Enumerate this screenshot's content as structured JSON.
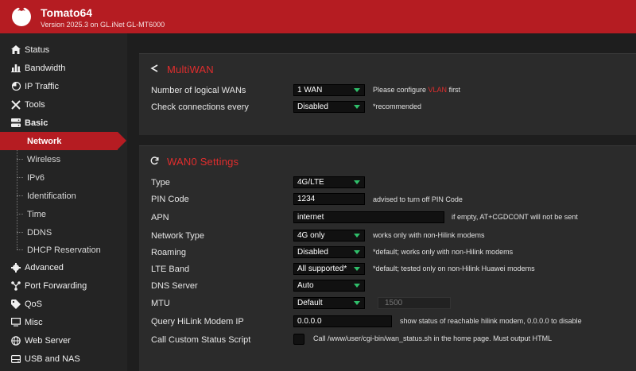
{
  "header": {
    "title": "Tomato64",
    "subtitle": "Version 2025.3 on GL.iNet GL-MT6000",
    "accent": "#b51c22"
  },
  "sidebar": {
    "items": [
      {
        "label": "Status",
        "icon": "home-icon"
      },
      {
        "label": "Bandwidth",
        "icon": "bar-chart-icon"
      },
      {
        "label": "IP Traffic",
        "icon": "pie-icon"
      },
      {
        "label": "Tools",
        "icon": "tools-icon"
      },
      {
        "label": "Basic",
        "icon": "server-icon"
      },
      {
        "label": "Advanced",
        "icon": "gear-icon"
      },
      {
        "label": "Port Forwarding",
        "icon": "network-icon"
      },
      {
        "label": "QoS",
        "icon": "tag-icon"
      },
      {
        "label": "Misc",
        "icon": "monitor-icon"
      },
      {
        "label": "Web Server",
        "icon": "globe-icon"
      },
      {
        "label": "USB and NAS",
        "icon": "drive-icon"
      }
    ],
    "basic_sub": [
      {
        "label": "Network",
        "active": true
      },
      {
        "label": "Wireless"
      },
      {
        "label": "IPv6"
      },
      {
        "label": "Identification"
      },
      {
        "label": "Time"
      },
      {
        "label": "DDNS"
      },
      {
        "label": "DHCP Reservation"
      }
    ]
  },
  "multiwan": {
    "title": "MultiWAN",
    "rows": {
      "logical_wans": {
        "label": "Number of logical WANs",
        "value": "1 WAN",
        "hint_pre": "Please configure ",
        "hint_link": "VLAN",
        "hint_post": " first"
      },
      "check_every": {
        "label": "Check connections every",
        "value": "Disabled",
        "hint": "*recommended"
      }
    }
  },
  "wan0": {
    "title": "WAN0 Settings",
    "rows": {
      "type": {
        "label": "Type",
        "value": "4G/LTE"
      },
      "pin": {
        "label": "PIN Code",
        "value": "1234",
        "hint": "advised to turn off PIN Code"
      },
      "apn": {
        "label": "APN",
        "value": "internet",
        "hint": "if empty, AT+CGDCONT will not be sent"
      },
      "network_type": {
        "label": "Network Type",
        "value": "4G only",
        "hint": "works only with non-Hilink modems"
      },
      "roaming": {
        "label": "Roaming",
        "value": "Disabled",
        "hint": "*default; works only with non-Hilink modems"
      },
      "lte_band": {
        "label": "LTE Band",
        "value": "All supported*",
        "hint": "*default; tested only on non-Hilink Huawei modems"
      },
      "dns": {
        "label": "DNS Server",
        "value": "Auto"
      },
      "mtu": {
        "label": "MTU",
        "value": "Default",
        "mtu_value": "1500"
      },
      "hilink_ip": {
        "label": "Query HiLink Modem IP",
        "value": "0.0.0.0",
        "hint": "show status of reachable hilink modem, 0.0.0.0 to disable"
      },
      "custom_script": {
        "label": "Call Custom Status Script",
        "hint": "Call /www/user/cgi-bin/wan_status.sh in the home page. Must output HTML"
      }
    }
  }
}
